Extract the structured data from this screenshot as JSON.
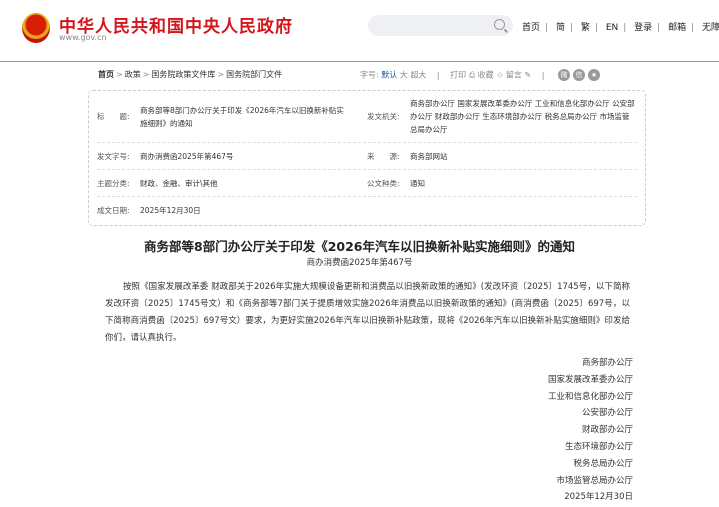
{
  "header": {
    "site_title": "中华人民共和国中央人民政府",
    "site_url": "www.gov.cn",
    "nav": [
      "首页",
      "简",
      "繁",
      "EN",
      "登录",
      "邮箱",
      "无障碍"
    ]
  },
  "breadcrumb": [
    "首页",
    "政策",
    "国务院政策文件库",
    "国务院部门文件"
  ],
  "toolbar": {
    "font_label": "字号:",
    "font_default": "默认",
    "font_large": "大",
    "font_xlarge": "超大",
    "print": "打印",
    "favorite": "收藏",
    "comment": "留言"
  },
  "info": {
    "title_label": "标　　题:",
    "title": "商务部等8部门办公厅关于印发《2026年汽车以旧换新补贴实施细则》的通知",
    "issuer_label": "发文机关:",
    "issuer": "商务部办公厅 国家发展改革委办公厅 工业和信息化部办公厅 公安部办公厅 财政部办公厅 生态环境部办公厅 税务总局办公厅 市场监管总局办公厅",
    "docno_label": "发文字号:",
    "docno": "商办消费函2025年第467号",
    "source_label": "来　　源:",
    "source": "商务部网站",
    "topic_label": "主题分类:",
    "topic": "财政、金融、审计\\其他",
    "type_label": "公文种类:",
    "type": "通知",
    "date_label": "成文日期:",
    "date": "2025年12月30日"
  },
  "doc": {
    "title": "商务部等8部门办公厅关于印发《2026年汽车以旧换新补贴实施细则》的通知",
    "number": "商办消费函2025年第467号",
    "body": "按照《国家发展改革委 财政部关于2026年实施大规模设备更新和消费品以旧换新政策的通知》(发改环资〔2025〕1745号，以下简称发改环资〔2025〕1745号文）和《商务部等7部门关于提质增效实施2026年消费品以旧换新政策的通知》(商消费函〔2025〕697号，以下简称商消费函〔2025〕697号文）要求，为更好实施2026年汽车以旧换新补贴政策，现将《2026年汽车以旧换新补贴实施细则》印发给你们，请认真执行。",
    "signatories": [
      "商务部办公厅",
      "国家发展改革委办公厅",
      "工业和信息化部办公厅",
      "公安部办公厅",
      "财政部办公厅",
      "生态环境部办公厅",
      "税务总局办公厅",
      "市场监管总局办公厅",
      "2025年12月30日"
    ]
  }
}
